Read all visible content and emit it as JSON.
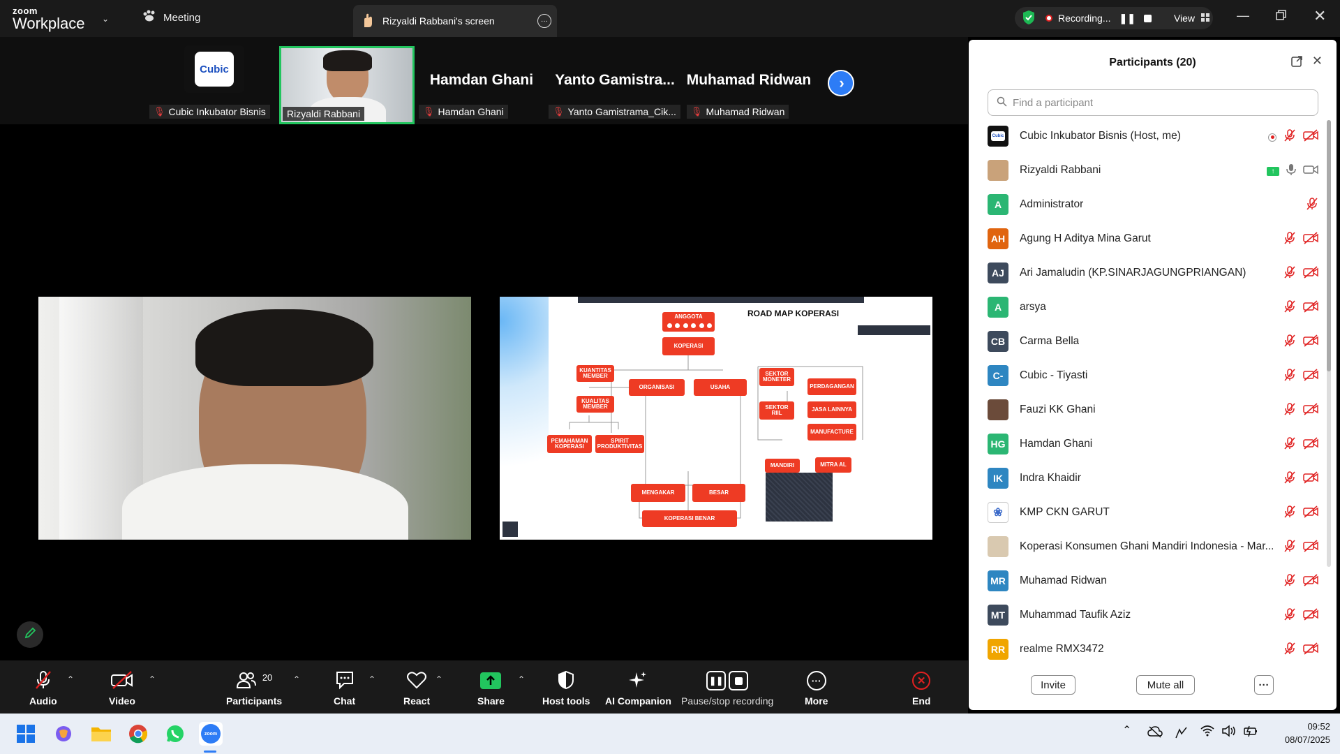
{
  "topbar": {
    "logo_top": "zoom",
    "logo_bottom": "Workplace",
    "meeting_tab": "Meeting",
    "screen_tab": "Rizyaldi Rabbani's screen",
    "recording_label": "Recording...",
    "view_label": "View"
  },
  "strip": {
    "tiles": [
      {
        "name": "Cubic Inkubator Bisnis",
        "logo": "Cubic"
      },
      {
        "name": "Rizyaldi Rabbani"
      },
      {
        "big": "Hamdan Ghani",
        "name": "Hamdan Ghani"
      },
      {
        "big": "Yanto  Gamistra...",
        "name": "Yanto Gamistrama_Cik..."
      },
      {
        "big": "Muhamad Ridwan",
        "name": "Muhamad Ridwan"
      }
    ]
  },
  "slide": {
    "title": "ROAD MAP KOPERASI",
    "anggota": "ANGGOTA",
    "koperasi": "KOPERASI",
    "kuantitas": "KUANTITAS MEMBER",
    "kualitas": "KUALITAS MEMBER",
    "organisasi": "ORGANISASI",
    "usaha": "USAHA",
    "pemahaman": "PEMAHAMAN KOPERASI",
    "spirit": "SPIRIT PRODUKTIVITAS",
    "sektor_moneter": "SEKTOR MONETER",
    "sektor_riil": "SEKTOR RIIL",
    "perdagangan": "PERDAGANGAN",
    "jasa": "JASA LAINNYA",
    "manufacture": "MANUFACTURE",
    "mandiri": "MANDIRI",
    "mitra": "MITRA AL",
    "mengakar": "MENGAKAR",
    "besar": "BESAR",
    "koperasi_benar": "KOPERASI BENAR"
  },
  "panel": {
    "title": "Participants (20)",
    "search_placeholder": "Find a participant",
    "participants": [
      {
        "initials": "",
        "name": "Cubic Inkubator Bisnis (Host, me)",
        "color": "#111111"
      },
      {
        "initials": "",
        "name": "Rizyaldi Rabbani",
        "color": "#c9a27a"
      },
      {
        "initials": "A",
        "name": "Administrator",
        "color": "#2bb673"
      },
      {
        "initials": "AH",
        "name": "Agung H Aditya Mina Garut",
        "color": "#e0640f"
      },
      {
        "initials": "AJ",
        "name": "Ari Jamaludin (KP.SINARJAGUNGPRIANGAN)",
        "color": "#3d4a5c"
      },
      {
        "initials": "A",
        "name": "arsya",
        "color": "#2bb673"
      },
      {
        "initials": "CB",
        "name": "Carma Bella",
        "color": "#3d4a5c"
      },
      {
        "initials": "C-",
        "name": "Cubic - Tiyasti",
        "color": "#2e86c1"
      },
      {
        "initials": "",
        "name": "Fauzi KK Ghani",
        "color": "#6b4b3a"
      },
      {
        "initials": "HG",
        "name": "Hamdan Ghani",
        "color": "#2bb673"
      },
      {
        "initials": "IK",
        "name": "Indra Khaidir",
        "color": "#2e86c1"
      },
      {
        "initials": "",
        "name": "KMP CKN GARUT",
        "color": "#ffffff"
      },
      {
        "initials": "",
        "name": "Koperasi Konsumen Ghani Mandiri Indonesia - Mar...",
        "color": "#d9c9b0"
      },
      {
        "initials": "MR",
        "name": "Muhamad Ridwan",
        "color": "#2e86c1"
      },
      {
        "initials": "MT",
        "name": "Muhammad Taufik Aziz",
        "color": "#3d4a5c"
      },
      {
        "initials": "RR",
        "name": "realme RMX3472",
        "color": "#f0a500"
      }
    ],
    "invite": "Invite",
    "mute_all": "Mute all",
    "more": "···"
  },
  "toolbar": {
    "audio": "Audio",
    "video": "Video",
    "participants": "Participants",
    "participants_count": "20",
    "chat": "Chat",
    "react": "React",
    "share": "Share",
    "host_tools": "Host tools",
    "ai_companion": "AI Companion",
    "pause_stop": "Pause/stop recording",
    "more": "More",
    "end": "End"
  },
  "taskbar": {
    "time": "09:52",
    "date": "08/07/2025"
  }
}
